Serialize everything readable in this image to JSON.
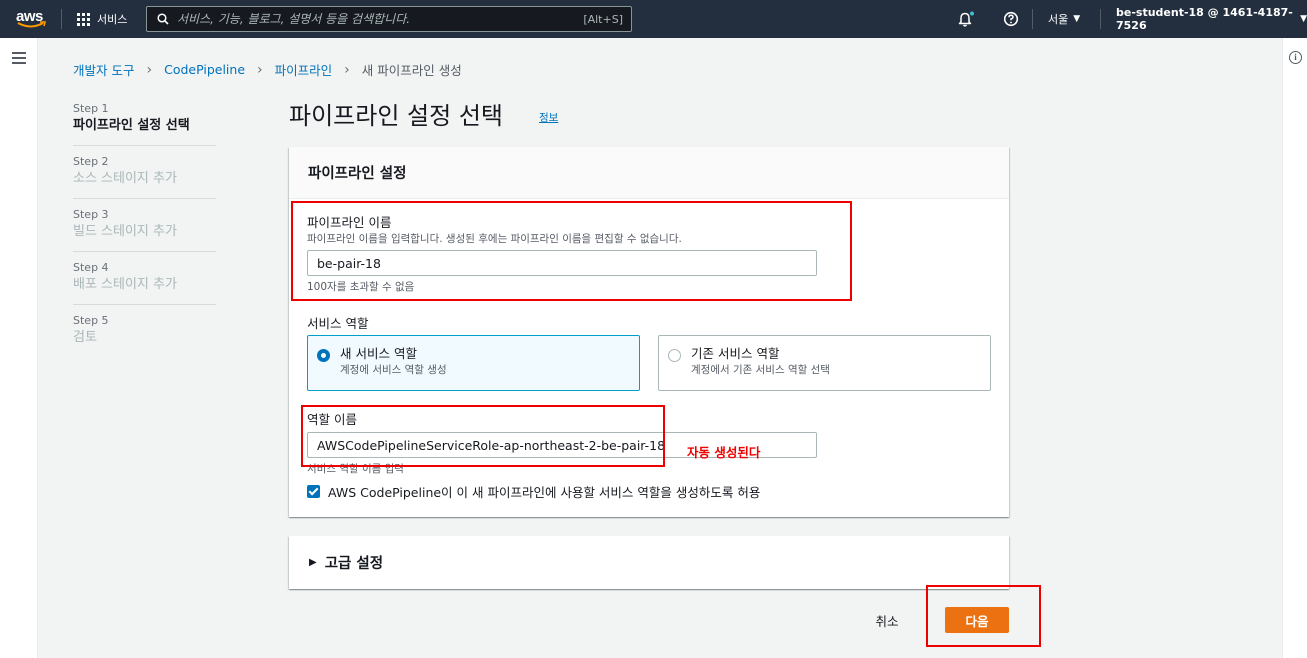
{
  "topnav": {
    "logo": "aws",
    "services_label": "서비스",
    "search_placeholder": "서비스, 기능, 블로그, 설명서 등을 검색합니다.",
    "search_shortcut": "[Alt+S]",
    "region": "서울",
    "account": "be-student-18 @ 1461-4187-7526"
  },
  "breadcrumb": {
    "items": [
      "개발자 도구",
      "CodePipeline",
      "파이프라인"
    ],
    "current": "새 파이프라인 생성"
  },
  "steps": [
    {
      "num": "Step 1",
      "label": "파이프라인 설정 선택",
      "active": true
    },
    {
      "num": "Step 2",
      "label": "소스 스테이지 추가",
      "active": false
    },
    {
      "num": "Step 3",
      "label": "빌드 스테이지 추가",
      "active": false
    },
    {
      "num": "Step 4",
      "label": "배포 스테이지 추가",
      "active": false
    },
    {
      "num": "Step 5",
      "label": "검토",
      "active": false
    }
  ],
  "page": {
    "title": "파이프라인 설정 선택",
    "info": "정보"
  },
  "card": {
    "header": "파이프라인 설정",
    "pipeline_name": {
      "label": "파이프라인 이름",
      "description": "파이프라인 이름을 입력합니다. 생성된 후에는 파이프라인 이름을 편집할 수 없습니다.",
      "value": "be-pair-18",
      "constraint": "100자를 초과할 수 없음"
    },
    "service_role": {
      "label": "서비스 역할",
      "options": [
        {
          "title": "새 서비스 역할",
          "desc": "계정에 서비스 역할 생성",
          "selected": true
        },
        {
          "title": "기존 서비스 역할",
          "desc": "계정에서 기존 서비스 역할 선택",
          "selected": false
        }
      ]
    },
    "role_name": {
      "label": "역할 이름",
      "value": "AWSCodePipelineServiceRole-ap-northeast-2-be-pair-18",
      "description": "서비스 역할 이름 입력"
    },
    "checkbox_label": "AWS CodePipeline이 이 새 파이프라인에 사용할 서비스 역할을 생성하도록 허용"
  },
  "advanced": {
    "label": "고급 설정"
  },
  "actions": {
    "cancel": "취소",
    "next": "다음"
  },
  "annotation": {
    "text": "자동 생성된다"
  },
  "colors": {
    "primary": "#0073bb",
    "accent": "#ec7211",
    "annotation": "#ee0000",
    "nav": "#232f3e"
  }
}
